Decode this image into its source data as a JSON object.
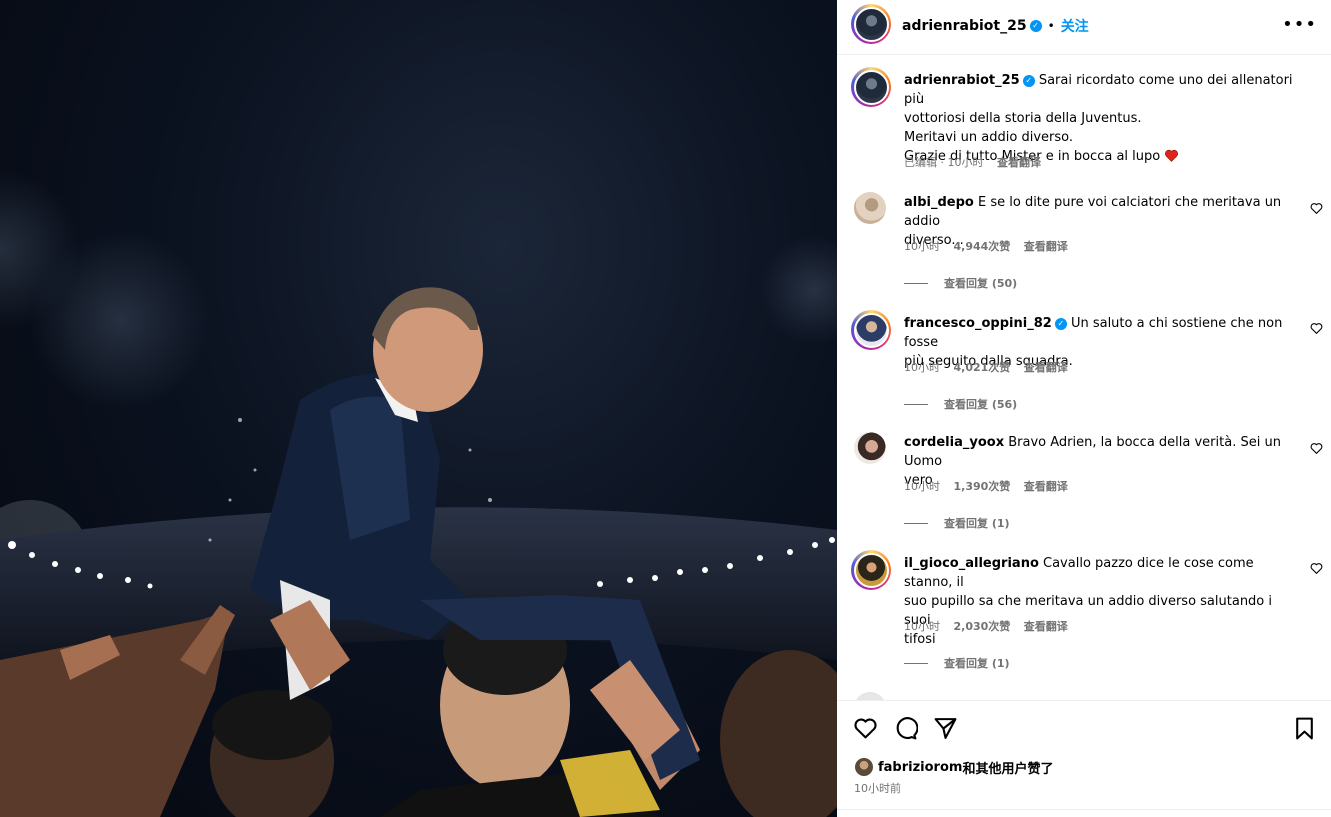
{
  "post": {
    "author": "adrienrabiot_25",
    "follow_label": "关注",
    "more_label": "•••",
    "caption": {
      "lines": [
        "Sarai ricordato come uno dei allenatori più",
        "vottoriosi della storia della Juventus.",
        "Meritavi un addio diverso.",
        "Grazie di tutto Mister e in bocca al lupo"
      ],
      "edited": "已编辑 · 10小时",
      "translate": "查看翻译"
    }
  },
  "comments": [
    {
      "username": "albi_depo",
      "verified": false,
      "text_lines": [
        "E se lo dite pure voi calciatori che meritava un addio",
        "diverso..."
      ],
      "time": "10小时",
      "likes": "4,944次赞",
      "translate": "查看翻译",
      "replies": "查看回复 (50)"
    },
    {
      "username": "francesco_oppini_82",
      "verified": true,
      "text_lines": [
        "Un saluto a chi sostiene che non fosse",
        "più seguito dalla squadra."
      ],
      "time": "10小时",
      "likes": "4,021次赞",
      "translate": "查看翻译",
      "replies": "查看回复 (56)"
    },
    {
      "username": "cordelia_yoox",
      "verified": false,
      "text_lines": [
        "Bravo Adrien, la bocca della verità. Sei un Uomo",
        "vero"
      ],
      "time": "10小时",
      "likes": "1,390次赞",
      "translate": "查看翻译",
      "replies": "查看回复 (1)"
    },
    {
      "username": "il_gioco_allegriano",
      "verified": false,
      "text_lines": [
        "Cavallo pazzo dice le cose come stanno, il",
        "suo pupillo sa che meritava un addio diverso salutando i suoi",
        "tifosi"
      ],
      "time": "10小时",
      "likes": "2,030次赞",
      "translate": "查看翻译",
      "replies": "查看回复 (1)"
    }
  ],
  "footer": {
    "liked_by_user": "fabriziorom",
    "liked_by_suffix": "和其他用户赞了",
    "posted_time": "10小时前"
  },
  "icons": {
    "like": "heart-icon",
    "comment": "comment-icon",
    "share": "share-icon",
    "save": "bookmark-icon",
    "more": "more-options-icon",
    "verified": "verified-badge-icon"
  },
  "colors": {
    "accent_blue": "#0095f6",
    "meta_gray": "#737373",
    "heart_red": "#e0241b"
  }
}
